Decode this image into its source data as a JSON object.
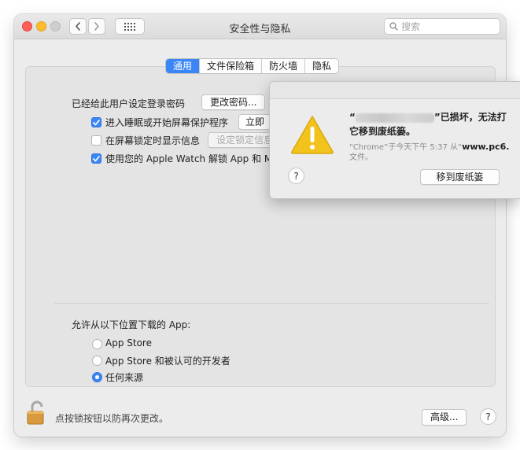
{
  "window": {
    "title": "安全性与隐私",
    "search_placeholder": "搜索"
  },
  "tabs": [
    {
      "label": "通用",
      "active": true
    },
    {
      "label": "文件保险箱",
      "active": false
    },
    {
      "label": "防火墙",
      "active": false
    },
    {
      "label": "隐私",
      "active": false
    }
  ],
  "general": {
    "password_label": "已经给此用户设定登录密码",
    "change_password_button": "更改密码...",
    "require_password_label": "进入睡眠或开始屏幕保护程序",
    "require_password_checked": true,
    "require_password_value": "立即",
    "lock_message_label": "在屏幕锁定时显示信息",
    "lock_message_checked": false,
    "set_lock_message_button": "设定锁定信息...",
    "apple_watch_label": "使用您的 Apple Watch 解锁 App 和 Mac",
    "apple_watch_checked": true
  },
  "downloads": {
    "label": "允许从以下位置下载的 App:",
    "options": [
      {
        "label": "App Store",
        "selected": false
      },
      {
        "label": "App Store 和被认可的开发者",
        "selected": false
      },
      {
        "label": "任何来源",
        "selected": true
      }
    ]
  },
  "footer": {
    "lock_text": "点按锁按钮以防再次更改。",
    "advanced_button": "高级...",
    "help": "?"
  },
  "dialog": {
    "heading_open_quote": "“",
    "heading_after_blur": "”已损坏，无法打",
    "heading_line2": "它移到废纸篓。",
    "info_prefix": "“Chrome”于今天下午 5:37 从“",
    "info_site": "www.pc6.",
    "info_line2": "文件。",
    "help": "?",
    "move_to_trash_button": "移到废纸篓"
  },
  "colors": {
    "accent": "#3b86f7",
    "warning": "#f2c31c"
  }
}
